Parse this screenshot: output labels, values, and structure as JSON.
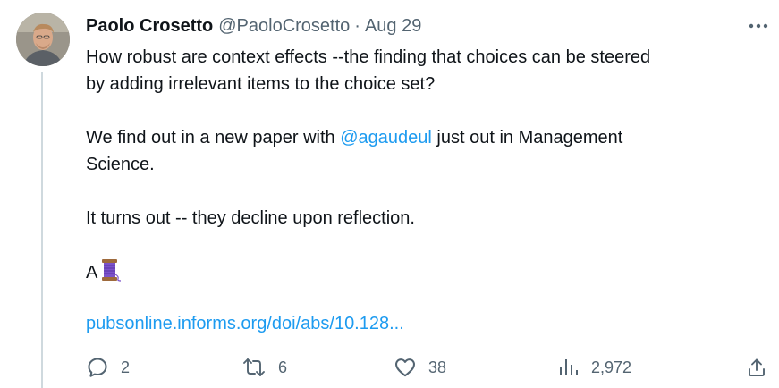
{
  "tweet": {
    "author_name": "Paolo Crosetto",
    "author_handle": "@PaoloCrosetto",
    "separator": "·",
    "date": "Aug 29",
    "paragraph1_line1": "How robust are context effects --the finding that choices can be steered",
    "paragraph1_line2": "by adding irrelevant items to the choice set?",
    "paragraph2_before": "We find out in a new paper with",
    "paragraph2_mention": "@agaudeul",
    "paragraph2_after": "just out in Management",
    "paragraph2_line2": "Science.",
    "paragraph3": "It turns out -- they decline upon reflection.",
    "paragraph4_text": "A",
    "paragraph4_emoji": "spool-of-thread-icon",
    "link_text": "pubsonline.informs.org/doi/abs/10.128..."
  },
  "actions": {
    "reply_count": "2",
    "retweet_count": "6",
    "like_count": "38",
    "views_count": "2,972"
  },
  "colors": {
    "text": "#0f1419",
    "secondary": "#536471",
    "link": "#1d9bf0",
    "thread_line": "#cfd9de"
  }
}
